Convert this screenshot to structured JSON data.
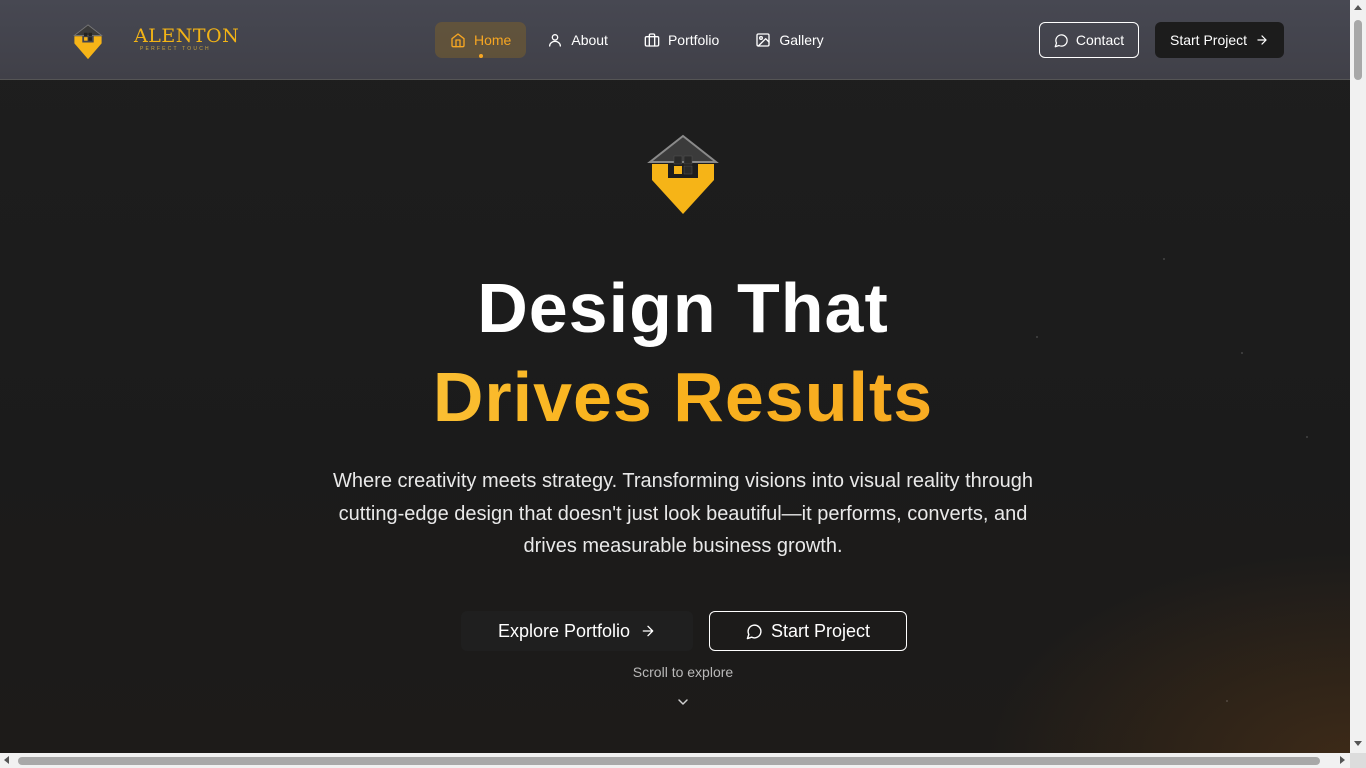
{
  "brand": {
    "name": "ALENTON",
    "tagline": "PERFECT TOUCH",
    "accent_color": "#f6a623"
  },
  "nav": {
    "items": [
      {
        "label": "Home",
        "icon": "home-icon",
        "active": true
      },
      {
        "label": "About",
        "icon": "user-icon",
        "active": false
      },
      {
        "label": "Portfolio",
        "icon": "briefcase-icon",
        "active": false
      },
      {
        "label": "Gallery",
        "icon": "image-icon",
        "active": false
      }
    ],
    "contact_label": "Contact",
    "start_label": "Start Project"
  },
  "hero": {
    "title_line1": "Design That",
    "title_line2": "Drives Results",
    "lead": "Where creativity meets strategy. Transforming visions into visual reality through cutting-edge design that doesn't just look beautiful—it performs, converts, and drives measurable business growth.",
    "explore_label": "Explore Portfolio",
    "start_label": "Start Project",
    "scroll_hint": "Scroll to explore"
  }
}
